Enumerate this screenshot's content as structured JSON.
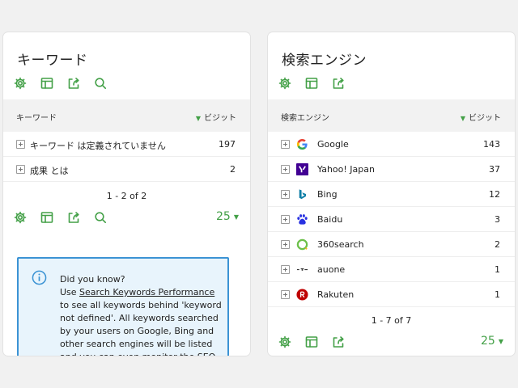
{
  "keywords_card": {
    "title": "キーワード",
    "columns": {
      "label": "キーワード",
      "value": "ビジット"
    },
    "sort_indicator": "▼",
    "rows": [
      {
        "label": "キーワード は定義されていません",
        "value": "197"
      },
      {
        "label": "成果 とは",
        "value": "2"
      }
    ],
    "pagination": "1 - 2 of 2",
    "limit": "25",
    "limit_caret": "▼",
    "notice": {
      "line1": "Did you know?",
      "line2_prefix": "Use ",
      "link": "Search Keywords Performance",
      "rest": " to see all keywords behind 'keyword not defined'. All keywords searched by your users on Google, Bing and other search engines will be listed and you can even monitor the SEO"
    }
  },
  "engines_card": {
    "title": "検索エンジン",
    "columns": {
      "label": "検索エンジン",
      "value": "ビジット"
    },
    "sort_indicator": "▼",
    "rows": [
      {
        "label": "Google",
        "value": "143",
        "icon": "google-logo-icon"
      },
      {
        "label": "Yahoo! Japan",
        "value": "37",
        "icon": "yahoo-logo-icon"
      },
      {
        "label": "Bing",
        "value": "12",
        "icon": "bing-logo-icon"
      },
      {
        "label": "Baidu",
        "value": "3",
        "icon": "baidu-logo-icon"
      },
      {
        "label": "360search",
        "value": "2",
        "icon": "360search-logo-icon"
      },
      {
        "label": "auone",
        "value": "1",
        "icon": "auone-logo-icon"
      },
      {
        "label": "Rakuten",
        "value": "1",
        "icon": "rakuten-logo-icon"
      }
    ],
    "pagination": "1 - 7 of 7",
    "limit": "25",
    "limit_caret": "▼"
  },
  "colors": {
    "accent": "#43a047",
    "notice_border": "#3b93d4",
    "notice_bg": "#e8f4fc"
  },
  "icons": [
    "gear-icon",
    "table-icon",
    "export-icon",
    "search-icon",
    "info-icon"
  ]
}
